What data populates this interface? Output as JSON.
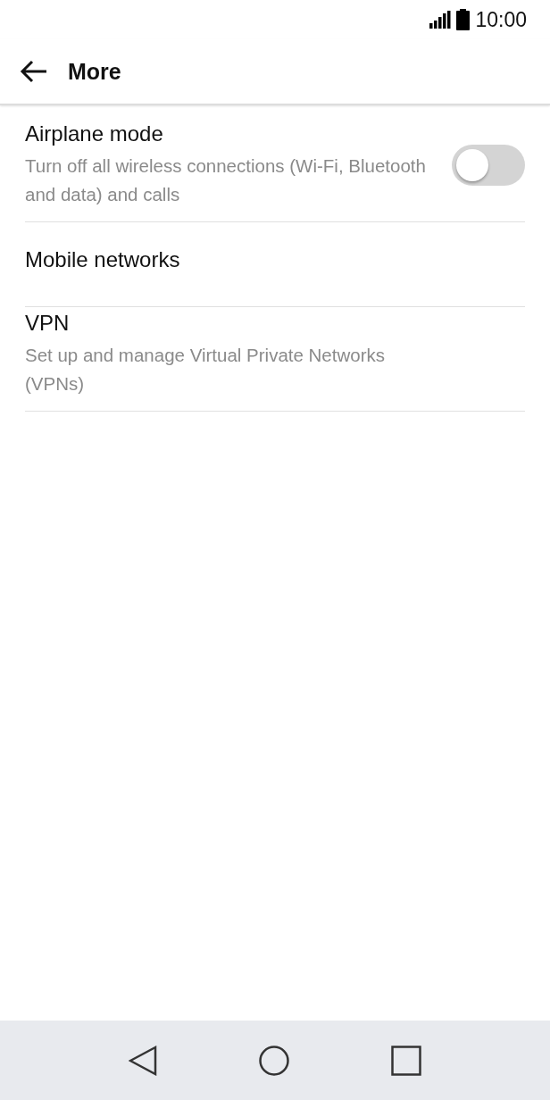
{
  "status_bar": {
    "time": "10:00"
  },
  "header": {
    "title": "More"
  },
  "items": [
    {
      "kind": "toggle",
      "title": "Airplane mode",
      "subtitle": "Turn off all wireless connections (Wi-Fi, Bluetooth and data) and calls",
      "on": false
    },
    {
      "kind": "plain",
      "title": "Mobile networks"
    },
    {
      "kind": "plain",
      "title": "VPN",
      "subtitle": "Set up and manage Virtual Private Networks (VPNs)"
    }
  ]
}
